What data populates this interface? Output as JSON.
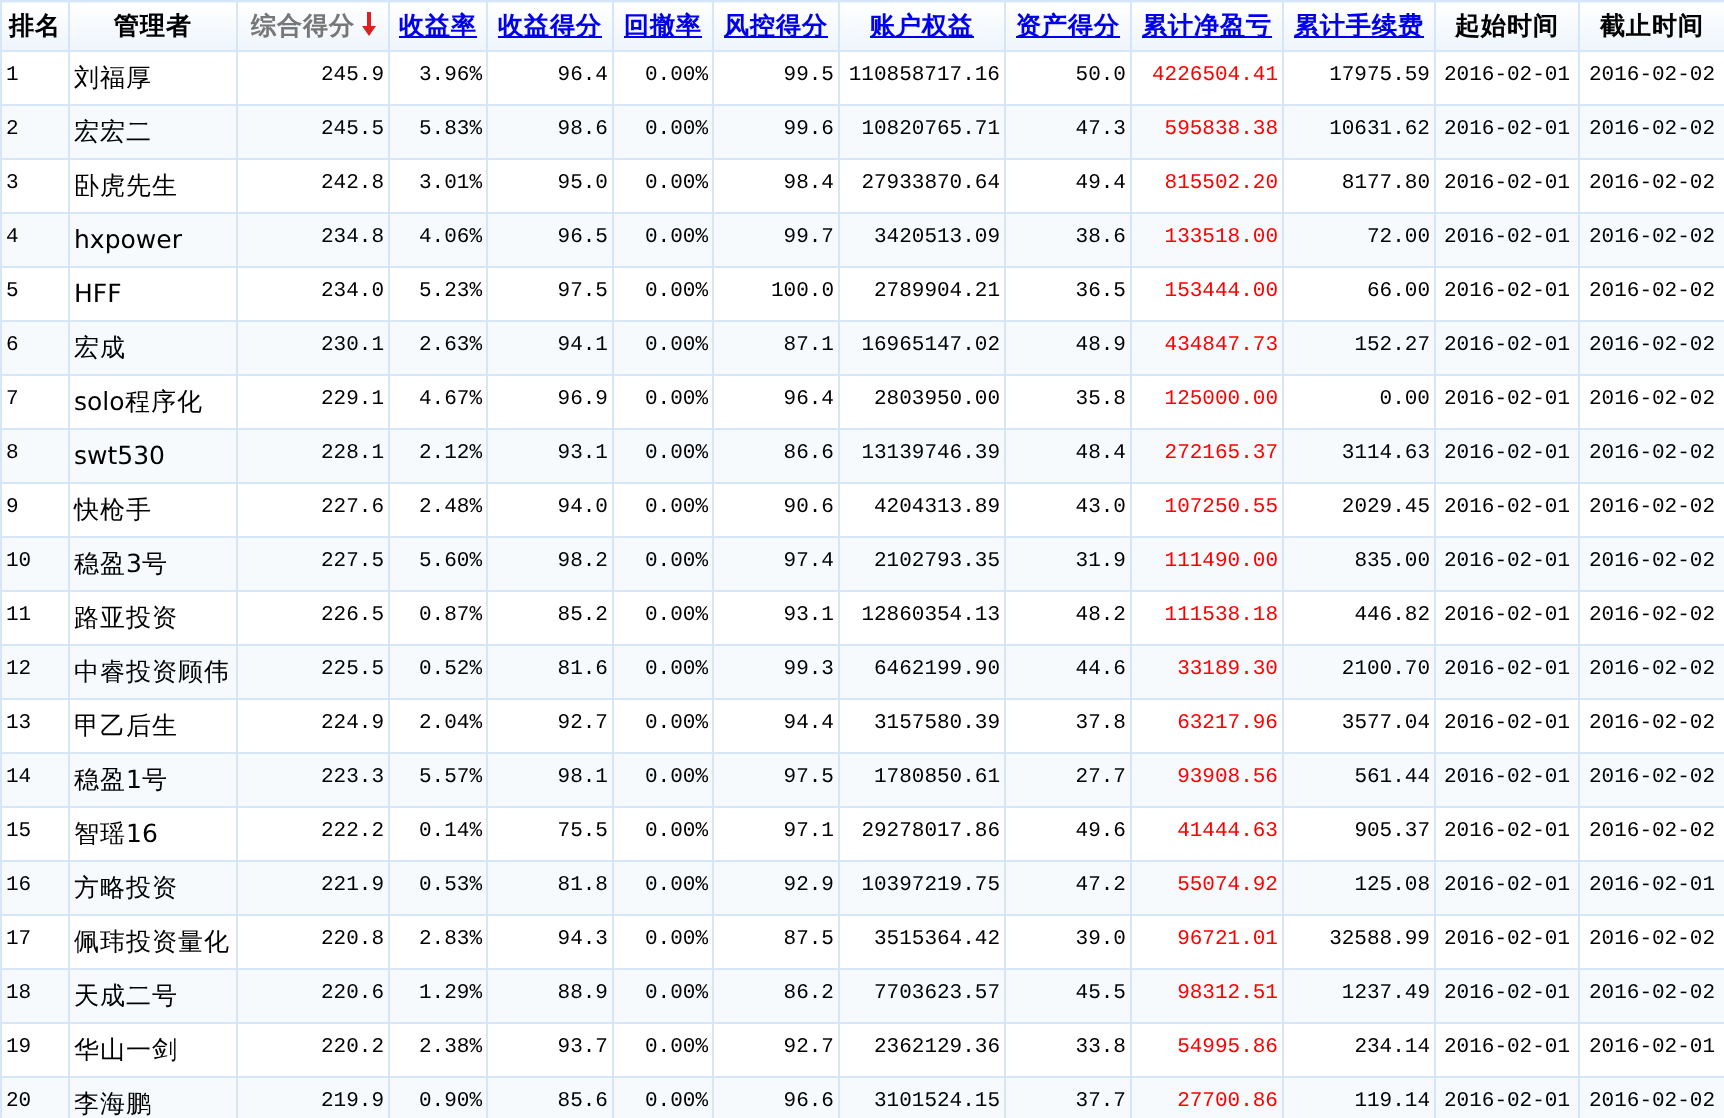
{
  "table": {
    "columns": [
      {
        "label": "排名",
        "link": false,
        "sorted": false,
        "kind": "text"
      },
      {
        "label": "管理者",
        "link": false,
        "sorted": false,
        "kind": "text"
      },
      {
        "label": "综合得分",
        "link": false,
        "sorted": true,
        "kind": "number"
      },
      {
        "label": "收益率",
        "link": true,
        "sorted": false,
        "kind": "number"
      },
      {
        "label": "收益得分",
        "link": true,
        "sorted": false,
        "kind": "number"
      },
      {
        "label": "回撤率",
        "link": true,
        "sorted": false,
        "kind": "number"
      },
      {
        "label": "风控得分",
        "link": true,
        "sorted": false,
        "kind": "number"
      },
      {
        "label": "账户权益",
        "link": true,
        "sorted": false,
        "kind": "number"
      },
      {
        "label": "资产得分",
        "link": true,
        "sorted": false,
        "kind": "number"
      },
      {
        "label": "累计净盈亏",
        "link": true,
        "sorted": false,
        "kind": "number",
        "color": "#ff0000"
      },
      {
        "label": "累计手续费",
        "link": true,
        "sorted": false,
        "kind": "number"
      },
      {
        "label": "起始时间",
        "link": false,
        "sorted": false,
        "kind": "date"
      },
      {
        "label": "截止时间",
        "link": false,
        "sorted": false,
        "kind": "date"
      }
    ],
    "rows": [
      [
        "1",
        "刘福厚",
        "245.9",
        "3.96%",
        "96.4",
        "0.00%",
        "99.5",
        "110858717.16",
        "50.0",
        "4226504.41",
        "17975.59",
        "2016-02-01",
        "2016-02-02"
      ],
      [
        "2",
        "宏宏二",
        "245.5",
        "5.83%",
        "98.6",
        "0.00%",
        "99.6",
        "10820765.71",
        "47.3",
        "595838.38",
        "10631.62",
        "2016-02-01",
        "2016-02-02"
      ],
      [
        "3",
        "卧虎先生",
        "242.8",
        "3.01%",
        "95.0",
        "0.00%",
        "98.4",
        "27933870.64",
        "49.4",
        "815502.20",
        "8177.80",
        "2016-02-01",
        "2016-02-02"
      ],
      [
        "4",
        "hxpower",
        "234.8",
        "4.06%",
        "96.5",
        "0.00%",
        "99.7",
        "3420513.09",
        "38.6",
        "133518.00",
        "72.00",
        "2016-02-01",
        "2016-02-02"
      ],
      [
        "5",
        "HFF",
        "234.0",
        "5.23%",
        "97.5",
        "0.00%",
        "100.0",
        "2789904.21",
        "36.5",
        "153444.00",
        "66.00",
        "2016-02-01",
        "2016-02-02"
      ],
      [
        "6",
        "宏成",
        "230.1",
        "2.63%",
        "94.1",
        "0.00%",
        "87.1",
        "16965147.02",
        "48.9",
        "434847.73",
        "152.27",
        "2016-02-01",
        "2016-02-02"
      ],
      [
        "7",
        "solo程序化",
        "229.1",
        "4.67%",
        "96.9",
        "0.00%",
        "96.4",
        "2803950.00",
        "35.8",
        "125000.00",
        "0.00",
        "2016-02-01",
        "2016-02-02"
      ],
      [
        "8",
        "swt530",
        "228.1",
        "2.12%",
        "93.1",
        "0.00%",
        "86.6",
        "13139746.39",
        "48.4",
        "272165.37",
        "3114.63",
        "2016-02-01",
        "2016-02-02"
      ],
      [
        "9",
        "快枪手",
        "227.6",
        "2.48%",
        "94.0",
        "0.00%",
        "90.6",
        "4204313.89",
        "43.0",
        "107250.55",
        "2029.45",
        "2016-02-01",
        "2016-02-02"
      ],
      [
        "10",
        "稳盈3号",
        "227.5",
        "5.60%",
        "98.2",
        "0.00%",
        "97.4",
        "2102793.35",
        "31.9",
        "111490.00",
        "835.00",
        "2016-02-01",
        "2016-02-02"
      ],
      [
        "11",
        "路亚投资",
        "226.5",
        "0.87%",
        "85.2",
        "0.00%",
        "93.1",
        "12860354.13",
        "48.2",
        "111538.18",
        "446.82",
        "2016-02-01",
        "2016-02-02"
      ],
      [
        "12",
        "中睿投资顾伟",
        "225.5",
        "0.52%",
        "81.6",
        "0.00%",
        "99.3",
        "6462199.90",
        "44.6",
        "33189.30",
        "2100.70",
        "2016-02-01",
        "2016-02-02"
      ],
      [
        "13",
        "甲乙后生",
        "224.9",
        "2.04%",
        "92.7",
        "0.00%",
        "94.4",
        "3157580.39",
        "37.8",
        "63217.96",
        "3577.04",
        "2016-02-01",
        "2016-02-02"
      ],
      [
        "14",
        "稳盈1号",
        "223.3",
        "5.57%",
        "98.1",
        "0.00%",
        "97.5",
        "1780850.61",
        "27.7",
        "93908.56",
        "561.44",
        "2016-02-01",
        "2016-02-02"
      ],
      [
        "15",
        "智瑶16",
        "222.2",
        "0.14%",
        "75.5",
        "0.00%",
        "97.1",
        "29278017.86",
        "49.6",
        "41444.63",
        "905.37",
        "2016-02-01",
        "2016-02-02"
      ],
      [
        "16",
        "方略投资",
        "221.9",
        "0.53%",
        "81.8",
        "0.00%",
        "92.9",
        "10397219.75",
        "47.2",
        "55074.92",
        "125.08",
        "2016-02-01",
        "2016-02-01"
      ],
      [
        "17",
        "佩玮投资量化",
        "220.8",
        "2.83%",
        "94.3",
        "0.00%",
        "87.5",
        "3515364.42",
        "39.0",
        "96721.01",
        "32588.99",
        "2016-02-01",
        "2016-02-02"
      ],
      [
        "18",
        "天成二号",
        "220.6",
        "1.29%",
        "88.9",
        "0.00%",
        "86.2",
        "7703623.57",
        "45.5",
        "98312.51",
        "1237.49",
        "2016-02-01",
        "2016-02-02"
      ],
      [
        "19",
        "华山一剑",
        "220.2",
        "2.38%",
        "93.7",
        "0.00%",
        "92.7",
        "2362129.36",
        "33.8",
        "54995.86",
        "234.14",
        "2016-02-01",
        "2016-02-01"
      ],
      [
        "20",
        "李海鹏",
        "219.9",
        "0.90%",
        "85.6",
        "0.00%",
        "96.6",
        "3101524.15",
        "37.7",
        "27700.86",
        "119.14",
        "2016-02-01",
        "2016-02-02"
      ]
    ]
  }
}
